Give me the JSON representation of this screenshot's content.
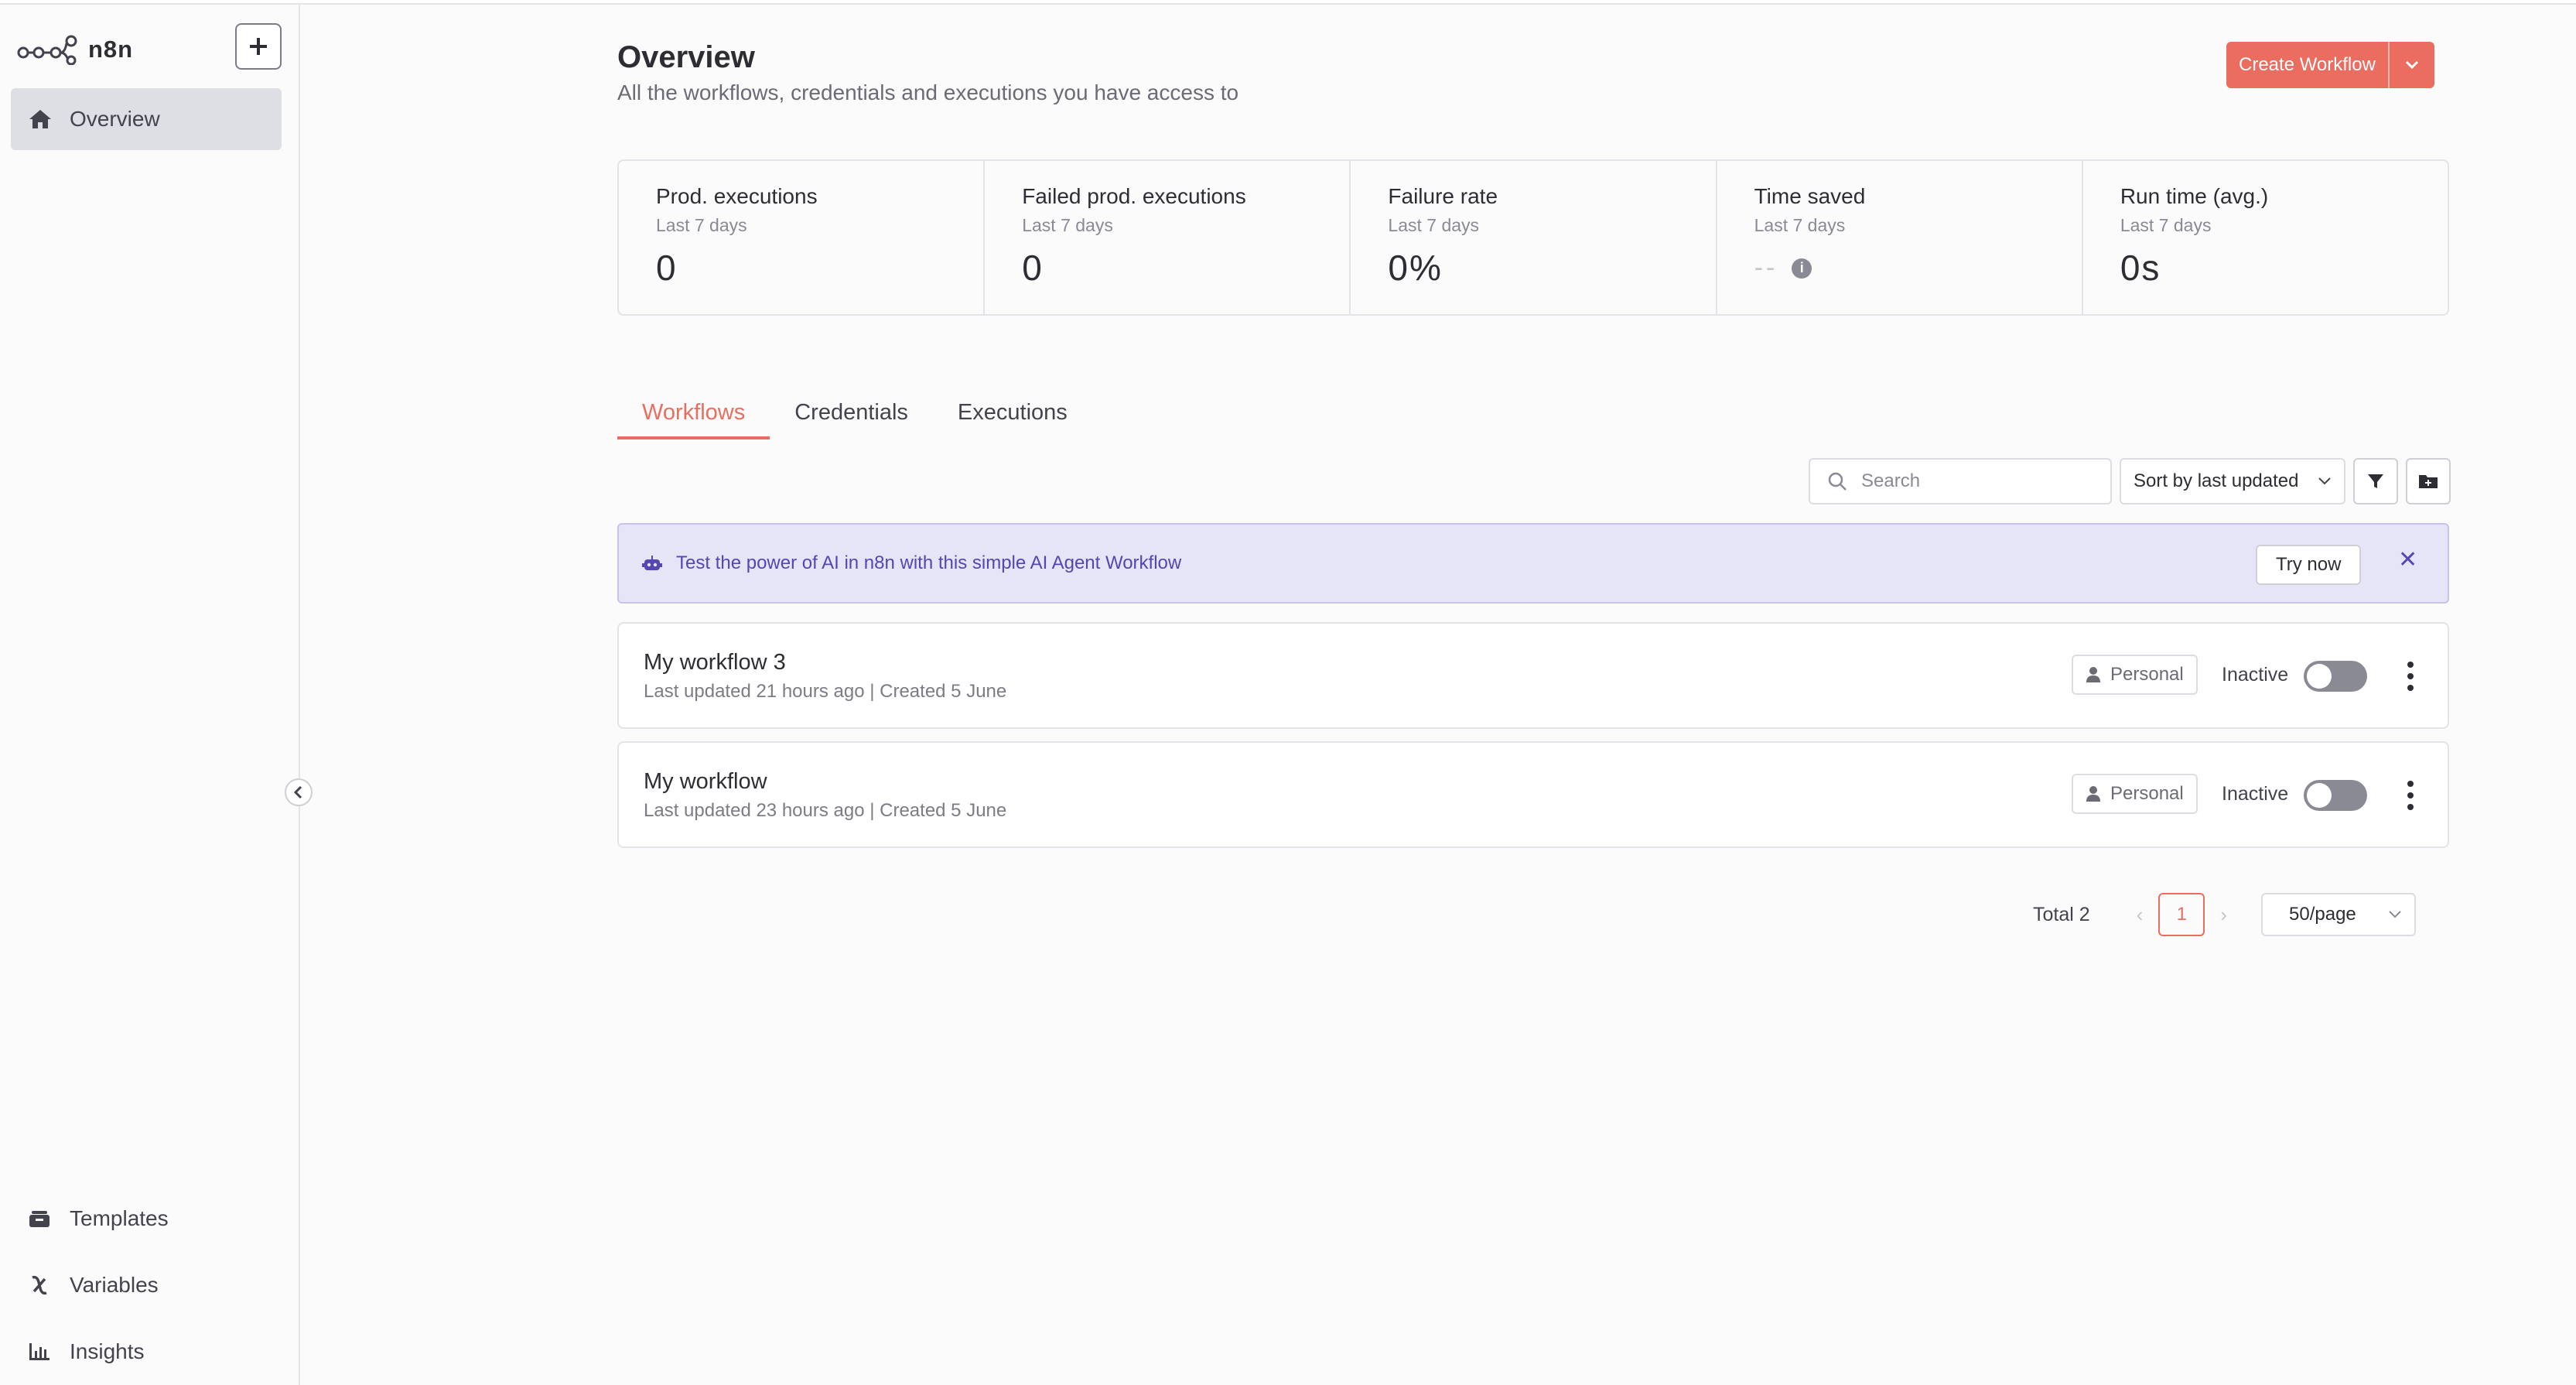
{
  "brand": {
    "name": "n8n"
  },
  "sidebar": {
    "overview_label": "Overview",
    "bottom_items": [
      {
        "label": "Templates",
        "icon": "templates-icon"
      },
      {
        "label": "Variables",
        "icon": "variables-icon"
      },
      {
        "label": "Insights",
        "icon": "insights-icon"
      }
    ]
  },
  "header": {
    "title": "Overview",
    "subtitle": "All the workflows, credentials and executions you have access to",
    "create_button": "Create Workflow"
  },
  "stats": [
    {
      "title": "Prod. executions",
      "period": "Last 7 days",
      "value": "0"
    },
    {
      "title": "Failed prod. executions",
      "period": "Last 7 days",
      "value": "0"
    },
    {
      "title": "Failure rate",
      "period": "Last 7 days",
      "value": "0%"
    },
    {
      "title": "Time saved",
      "period": "Last 7 days",
      "value": "--"
    },
    {
      "title": "Run time (avg.)",
      "period": "Last 7 days",
      "value": "0s"
    }
  ],
  "tabs": [
    {
      "label": "Workflows",
      "active": true
    },
    {
      "label": "Credentials",
      "active": false
    },
    {
      "label": "Executions",
      "active": false
    }
  ],
  "toolbar": {
    "search_placeholder": "Search",
    "sort_value": "Sort by last updated"
  },
  "banner": {
    "text": "Test the power of AI in n8n with this simple AI Agent Workflow",
    "button": "Try now"
  },
  "workflows": [
    {
      "name": "My workflow 3",
      "meta": "Last updated 21 hours ago | Created 5 June",
      "owner": "Personal",
      "status": "Inactive"
    },
    {
      "name": "My workflow",
      "meta": "Last updated 23 hours ago | Created 5 June",
      "owner": "Personal",
      "status": "Inactive"
    }
  ],
  "pagination": {
    "total": "Total 2",
    "current_page": "1",
    "per_page": "50/page"
  },
  "colors": {
    "accent": "#ea6d5f",
    "banner_bg": "#e6e4f7",
    "banner_text": "#5546b3"
  }
}
